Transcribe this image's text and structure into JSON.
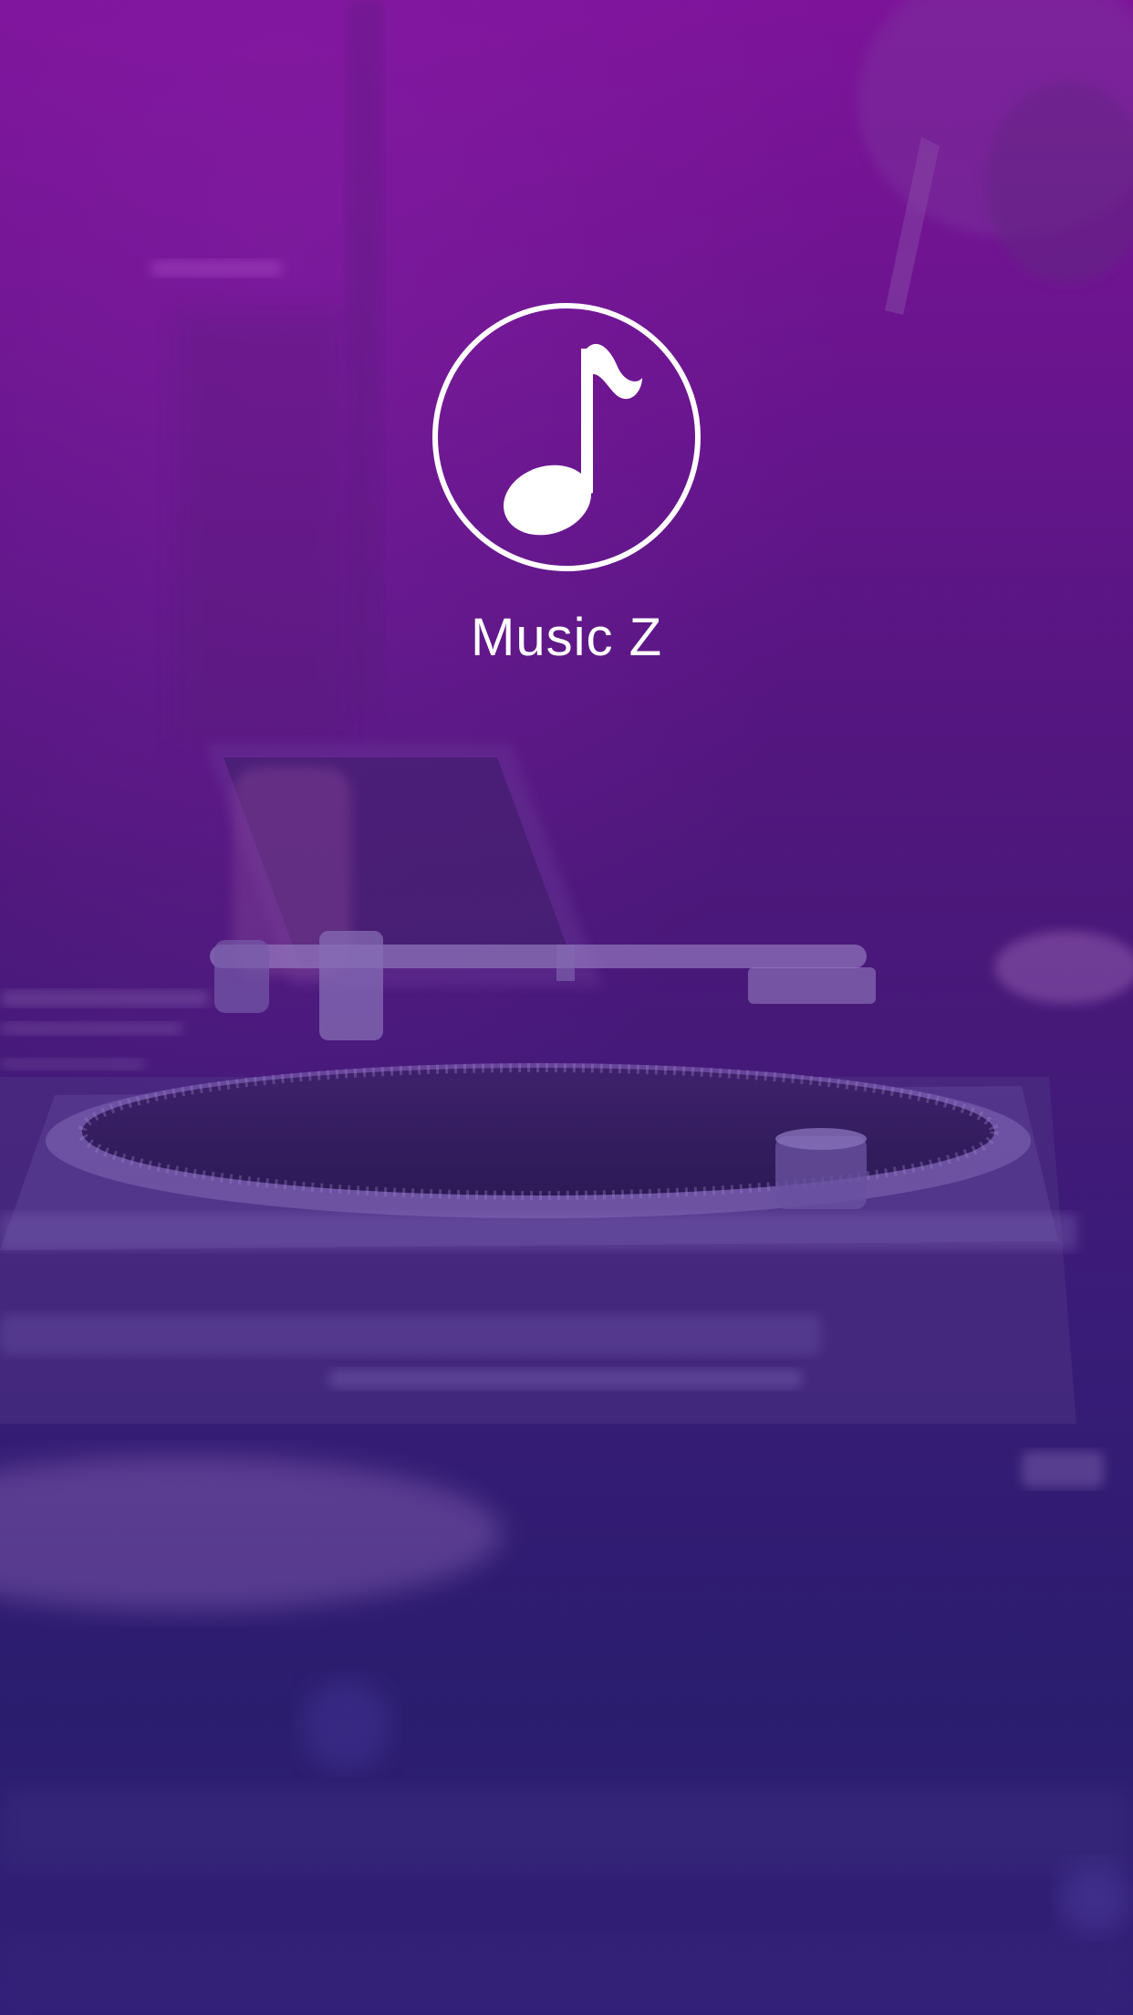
{
  "splash": {
    "app_name": "Music Z",
    "logo_icon": "music-note-icon",
    "background": "dj-turntable-photo"
  },
  "colors": {
    "gradient_top": "#7a1396",
    "gradient_bottom": "#2a1e6e",
    "text": "#ffffff"
  }
}
